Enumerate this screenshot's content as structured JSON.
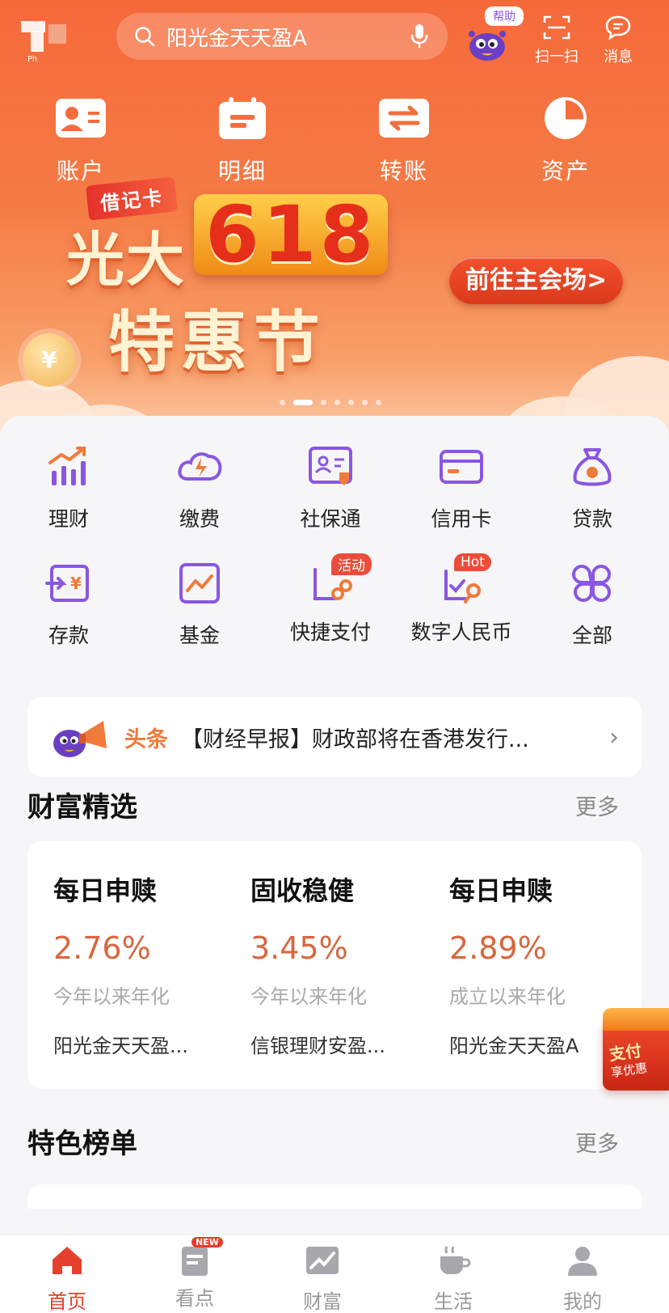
{
  "colors": {
    "accent": "#e5402b",
    "hero_top": "#f6693a",
    "purple_icon": "#8a56e2",
    "rate": "#d6673f"
  },
  "topbar": {
    "search_placeholder": "阳光金天天盈A",
    "help_label": "帮助",
    "scan_label": "扫一扫",
    "message_label": "消息",
    "logo_sub": "Ph"
  },
  "quick_actions": [
    {
      "label": "账户",
      "icon": "account-card-icon"
    },
    {
      "label": "明细",
      "icon": "statement-icon"
    },
    {
      "label": "转账",
      "icon": "transfer-icon"
    },
    {
      "label": "资产",
      "icon": "pie-chart-icon"
    }
  ],
  "banner": {
    "tag": "借记卡",
    "line1": "光大",
    "number": "618",
    "line2": "特惠节",
    "cta": "前往主会场>",
    "coin_symbol": "¥",
    "slide_count": 7,
    "active_slide": 1
  },
  "services": [
    {
      "label": "理财",
      "icon": "bar-chart-icon"
    },
    {
      "label": "缴费",
      "icon": "bolt-cloud-icon"
    },
    {
      "label": "社保通",
      "icon": "id-card-icon"
    },
    {
      "label": "信用卡",
      "icon": "credit-card-icon"
    },
    {
      "label": "贷款",
      "icon": "money-bag-icon"
    },
    {
      "label": "存款",
      "icon": "deposit-icon"
    },
    {
      "label": "基金",
      "icon": "fund-chart-icon"
    },
    {
      "label": "快捷支付",
      "icon": "quick-pay-icon",
      "badge": "活动"
    },
    {
      "label": "数字人民币",
      "icon": "digital-rmb-icon",
      "badge": "Hot"
    },
    {
      "label": "全部",
      "icon": "grid-all-icon"
    }
  ],
  "headline": {
    "keyword": "头条",
    "text": "【财经早报】财政部将在香港发行..."
  },
  "wealth": {
    "title": "财富精选",
    "more": "更多",
    "products": [
      {
        "type": "每日申赎",
        "rate": "2.76%",
        "rate_desc": "今年以来年化",
        "name": "阳光金天天盈..."
      },
      {
        "type": "固收稳健",
        "rate": "3.45%",
        "rate_desc": "今年以来年化",
        "name": "信银理财安盈..."
      },
      {
        "type": "每日申赎",
        "rate": "2.89%",
        "rate_desc": "成立以来年化",
        "name": "阳光金天天盈A"
      }
    ]
  },
  "pay_float": {
    "line1": "支付",
    "line2": "享优惠"
  },
  "ranking": {
    "title": "特色榜单",
    "more": "更多"
  },
  "tabs": [
    {
      "label": "首页",
      "icon": "home-icon",
      "active": true
    },
    {
      "label": "看点",
      "icon": "news-icon",
      "badge": "NEW"
    },
    {
      "label": "财富",
      "icon": "trend-icon"
    },
    {
      "label": "生活",
      "icon": "coffee-cup-icon"
    },
    {
      "label": "我的",
      "icon": "user-icon"
    }
  ]
}
